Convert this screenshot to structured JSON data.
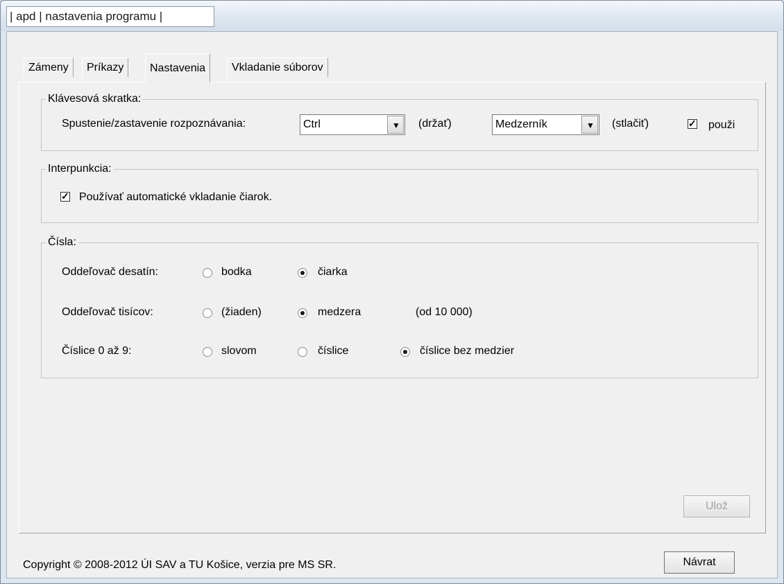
{
  "window": {
    "title": "| apd | nastavenia programu |"
  },
  "tabs": [
    {
      "label": "Zámeny"
    },
    {
      "label": "Príkazy"
    },
    {
      "label": "Nastavenia"
    },
    {
      "label": "Vkladanie súborov"
    }
  ],
  "shortcut": {
    "group_title": "Klávesová skratka:",
    "label": "Spustenie/zastavenie rozpoznávania:",
    "key1_value": "Ctrl",
    "key1_hint": "(držať)",
    "key2_value": "Medzerník",
    "key2_hint": "(stlačiť)",
    "use_label": "použi",
    "use_checked": true
  },
  "punctuation": {
    "group_title": "Interpunkcia:",
    "auto_commas_label": "Používať automatické vkladanie čiarok.",
    "auto_commas_checked": true
  },
  "numbers": {
    "group_title": "Čísla:",
    "decimal_label": "Oddeľovač desatín:",
    "decimal_options": [
      "bodka",
      "čiarka"
    ],
    "decimal_selected": "čiarka",
    "thousands_label": "Oddeľovač tisícov:",
    "thousands_options": [
      "(žiaden)",
      "medzera"
    ],
    "thousands_selected": "medzera",
    "thousands_note": "(od 10 000)",
    "digits_label": "Číslice 0 až 9:",
    "digits_options": [
      "slovom",
      "číslice",
      "číslice bez medzier"
    ],
    "digits_selected": "číslice bez medzier"
  },
  "buttons": {
    "save_label": "Ulož",
    "back_label": "Návrat"
  },
  "footer": {
    "copyright": "Copyright © 2008-2012 ÚI SAV a TU Košice, verzia pre MS SR."
  }
}
